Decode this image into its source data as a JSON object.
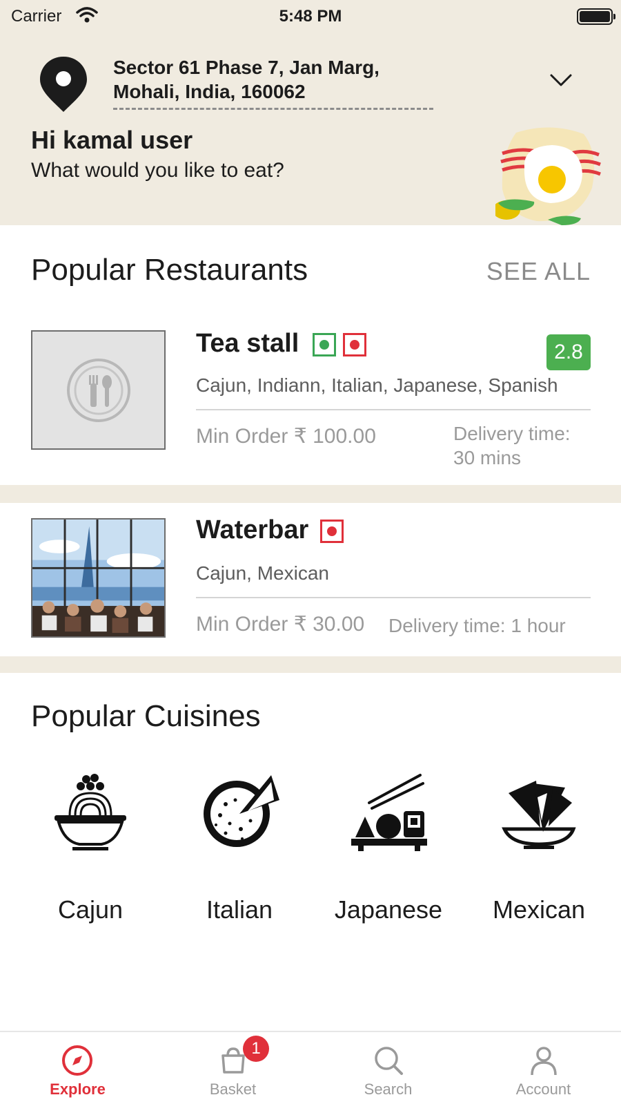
{
  "status_bar": {
    "carrier": "Carrier",
    "time": "5:48 PM"
  },
  "header": {
    "address": "Sector 61 Phase 7, Jan Marg, Mohali, India, 160062",
    "greeting": "Hi kamal user",
    "subgreeting": "What would you like to eat?"
  },
  "restaurants_section": {
    "title": "Popular Restaurants",
    "see_all_label": "SEE ALL"
  },
  "restaurants": [
    {
      "name": "Tea stall",
      "badges": [
        "veg",
        "non-veg"
      ],
      "rating": "2.8",
      "cuisines": "Cajun, Indiann, Italian, Japanese, Spanish",
      "min_order": "Min Order ₹ 100.00",
      "delivery": "Delivery time: 30 mins"
    },
    {
      "name": "Waterbar",
      "badges": [
        "non-veg"
      ],
      "cuisines": "Cajun, Mexican",
      "min_order": "Min Order ₹ 30.00",
      "delivery": "Delivery time: 1 hour"
    }
  ],
  "cuisines_section": {
    "title": "Popular Cuisines"
  },
  "cuisines": [
    {
      "label": "Cajun",
      "icon": "noodle-bowl-icon"
    },
    {
      "label": "Italian",
      "icon": "pizza-icon"
    },
    {
      "label": "Japanese",
      "icon": "sushi-icon"
    },
    {
      "label": "Mexican",
      "icon": "nachos-icon"
    }
  ],
  "tabbar": {
    "tabs": [
      {
        "label": "Explore",
        "icon": "compass-icon",
        "active": true
      },
      {
        "label": "Basket",
        "icon": "basket-icon",
        "badge": "1"
      },
      {
        "label": "Search",
        "icon": "search-icon"
      },
      {
        "label": "Account",
        "icon": "person-icon"
      }
    ]
  },
  "colors": {
    "header_bg": "#f0ebe0",
    "accent": "#e0303a",
    "rating_bg": "#4caf50",
    "veg": "#3aa655",
    "non_veg": "#e0303a"
  }
}
